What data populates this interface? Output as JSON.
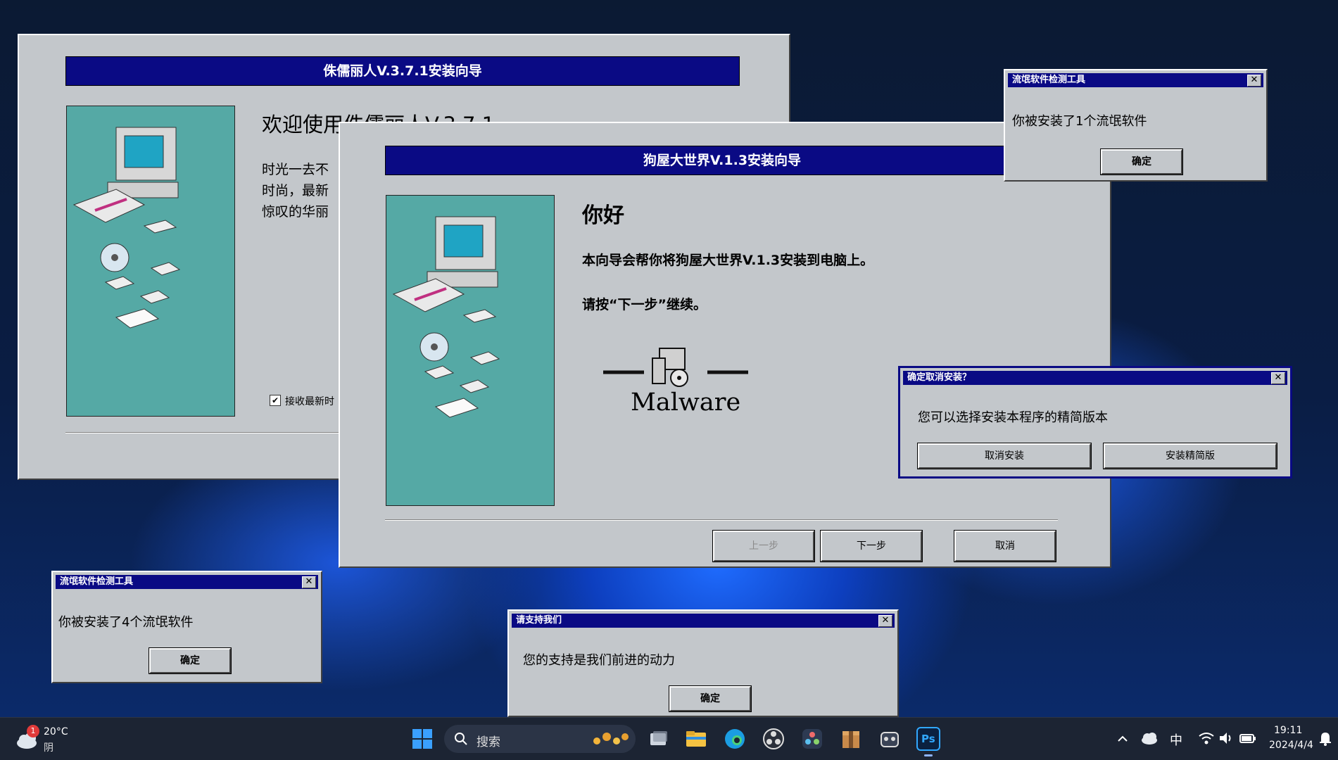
{
  "installer1": {
    "banner": "侏儒丽人V.3.7.1安装向导",
    "heading": "欢迎使用侏儒丽人V.3.7.1",
    "lines": [
      "时光一去不",
      "时尚，最新",
      "惊叹的华丽"
    ],
    "checkbox_label": "接收最新时"
  },
  "installer2": {
    "banner": "狗屋大世界V.1.3安装向导",
    "heading": "你好",
    "line1": "本向导会帮你将狗屋大世界V.1.3安装到电脑上。",
    "line2": "请按“下一步”继续。",
    "logo_text": "Malware",
    "back_label": "上一步",
    "next_label": "下一步",
    "cancel_label": "取消"
  },
  "dialog_top": {
    "title": "流氓软件检测工具",
    "message": "你被安装了1个流氓软件",
    "ok_label": "确定",
    "close": "✕"
  },
  "dialog_cancel": {
    "title": "确定取消安装？",
    "message": "您可以选择安装本程序的精简版本",
    "cancel_install_label": "取消安装",
    "lite_label": "安装精简版",
    "close": "✕"
  },
  "dialog_left": {
    "title": "流氓软件检测工具",
    "message": "你被安装了4个流氓软件",
    "ok_label": "确定",
    "close": "✕"
  },
  "dialog_support": {
    "title": "请支持我们",
    "message": "您的支持是我们前进的动力",
    "ok_label": "确定",
    "close": "✕"
  },
  "taskbar": {
    "weather_temp": "20°C",
    "weather_desc": "阴",
    "weather_badge": "1",
    "search_placeholder": "搜索",
    "ps_label": "Ps",
    "ime": "中",
    "time": "19:11",
    "date": "2024/4/4"
  },
  "colors": {
    "title_blue": "#0a0a84",
    "window_gray": "#c3c7cb",
    "teal_panel": "#55a9a5"
  }
}
